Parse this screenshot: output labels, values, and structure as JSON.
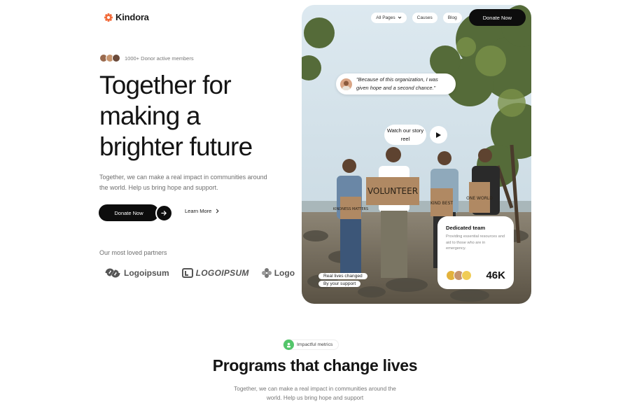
{
  "brand": {
    "name": "Kindora",
    "accent": "#f26b3a"
  },
  "hero": {
    "members_text": "1000+ Donor active members",
    "title_lines": [
      "Together for",
      "making a",
      "brighter future"
    ],
    "subtitle": "Together, we can make a real impact in communities around the world. Help us bring hope and support.",
    "donate_label": "Donate Now",
    "learn_more_label": "Learn More"
  },
  "partners": {
    "label": "Our most loved partners",
    "logos": [
      "Logoipsum",
      "LOGOIPSUM",
      "Logoipsum"
    ]
  },
  "nav": {
    "items": [
      "All Pages",
      "Causes",
      "Blog"
    ],
    "donate_label": "Donate Now"
  },
  "photo_card": {
    "quote": "\"Because of this organization, I was given hope and a second chance.\"",
    "story_reel": "Watch our story reel",
    "lives_line1": "Real lives changed",
    "lives_line2": "By your support",
    "signs": [
      "VOLUNTEER",
      "KINDNESS MATTERS",
      "KIND BEST",
      "ONE WORLD"
    ],
    "team": {
      "title": "Dedicated team",
      "description": "Providing essential resources and aid to those who are in emergency.",
      "count": "46K"
    }
  },
  "programs": {
    "badge": "Impactful metrics",
    "title": "Programs that change lives",
    "subtitle": "Together, we can make a real impact in communities around the world. Help us bring hope and support"
  }
}
